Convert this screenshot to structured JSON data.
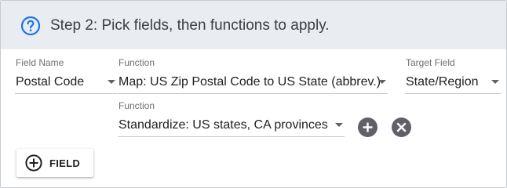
{
  "header": {
    "title": "Step 2: Pick fields, then functions to apply.",
    "help_icon": "help-circle-icon",
    "accent_color": "#1a73e8"
  },
  "row1": {
    "field_name": {
      "label": "Field Name",
      "value": "Postal Code"
    },
    "function": {
      "label": "Function",
      "value": "Map: US Zip Postal Code to US State (abbrev.)"
    },
    "target_field": {
      "label": "Target Field",
      "value": "State/Region"
    }
  },
  "row2": {
    "function": {
      "label": "Function",
      "value": "Standardize: US states, CA provinces"
    },
    "add_function_icon": "plus-circle-icon",
    "remove_function_icon": "close-circle-icon"
  },
  "add_field_button": {
    "label": "FIELD",
    "icon": "plus-circle-outline-icon"
  }
}
